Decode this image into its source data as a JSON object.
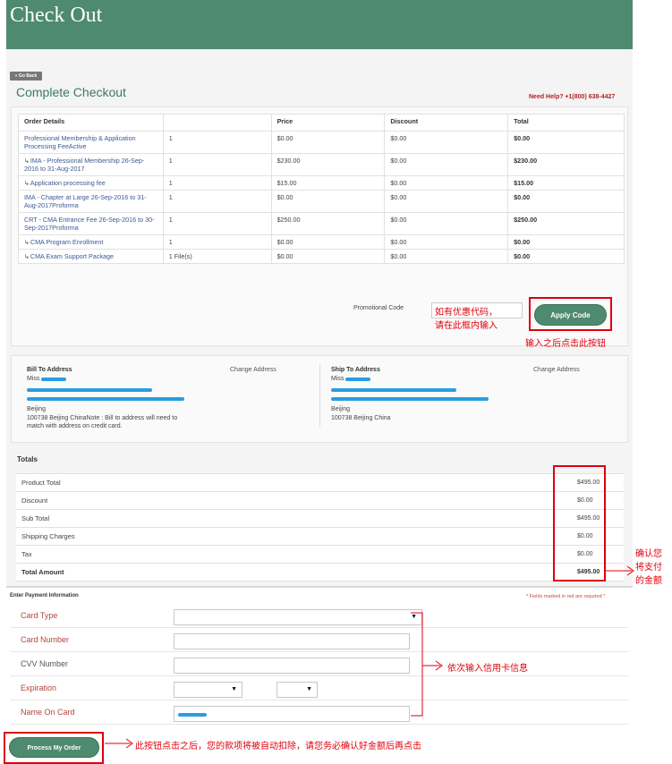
{
  "header": {
    "title": "Check Out"
  },
  "nav": {
    "go_back": "« Go Back"
  },
  "page": {
    "title": "Complete Checkout",
    "help": "Need Help? +1(800) 638-4427"
  },
  "order": {
    "columns": [
      "Order Details",
      "",
      "Price",
      "Discount",
      "Total"
    ],
    "rows": [
      {
        "sub": false,
        "item": "Professional Membership & Application Processing FeeActive",
        "qty": "1",
        "price": "$0.00",
        "discount": "$0.00",
        "total": "$0.00"
      },
      {
        "sub": true,
        "item": "IMA - Professional Membership 26-Sep-2016 to 31-Aug-2017",
        "qty": "1",
        "price": "$230.00",
        "discount": "$0.00",
        "total": "$230.00"
      },
      {
        "sub": true,
        "item": "Application processing fee",
        "qty": "1",
        "price": "$15.00",
        "discount": "$0.00",
        "total": "$15.00"
      },
      {
        "sub": false,
        "item": "IMA - Chapter at Large 26-Sep-2016 to 31-Aug-2017Proforma",
        "qty": "1",
        "price": "$0.00",
        "discount": "$0.00",
        "total": "$0.00"
      },
      {
        "sub": false,
        "item": "CRT - CMA Entrance Fee 26-Sep-2016 to 30-Sep-2017Proforma",
        "qty": "1",
        "price": "$250.00",
        "discount": "$0.00",
        "total": "$250.00"
      },
      {
        "sub": true,
        "item": "CMA Program Enrollment",
        "qty": "1",
        "price": "$0.00",
        "discount": "$0.00",
        "total": "$0.00"
      },
      {
        "sub": true,
        "item": "CMA Exam Support Package",
        "qty": "1 File(s)",
        "price": "$0.00",
        "discount": "$0.00",
        "total": "$0.00"
      }
    ],
    "promo_label": "Promotional Code",
    "apply_label": "Apply Code"
  },
  "address": {
    "bill_title": "Bill To Address",
    "bill_change": "Change Address",
    "bill_salutation": "Miss",
    "bill_city": "Beijing",
    "bill_zip_note": "100738 Beijing ChinaNote : Bill to address will need to",
    "bill_zip_note2": "match with address on credit card.",
    "ship_title": "Ship To Address",
    "ship_change": "Change Address",
    "ship_salutation": "Miss",
    "ship_city": "Beijing",
    "ship_zip": "100738 Beijing China"
  },
  "totals": {
    "title": "Totals",
    "rows": [
      {
        "label": "Product Total",
        "value": "$495.00"
      },
      {
        "label": "Discount",
        "value": "$0.00"
      },
      {
        "label": "Sub Total",
        "value": "$495.00"
      },
      {
        "label": "Shipping Charges",
        "value": "$0.00"
      },
      {
        "label": "Tax",
        "value": "$0.00"
      },
      {
        "label": "Total Amount",
        "value": "$495.00"
      }
    ]
  },
  "payment": {
    "title": "Enter Payment Information",
    "required_note": "* Fields marked in red are required *",
    "card_type": "Card Type",
    "card_number": "Card Number",
    "cvv": "CVV Number",
    "expiration": "Expiration",
    "name_on_card": "Name On Card",
    "process_label": "Process My Order"
  },
  "annotations": {
    "promo_hint_1": "如有优惠代码，",
    "promo_hint_2": "请在此框内输入",
    "apply_hint": "输入之后点击此按钮",
    "confirm_1": "确认您",
    "confirm_2": "将支付",
    "confirm_3": "的金额",
    "card_hint": "依次输入信用卡信息",
    "process_hint": "此按钮点击之后，您的款项将被自动扣除，请您务必确认好金额后再点击"
  },
  "colors": {
    "brand_green": "#4e8a6e",
    "annotation_red": "#e0000d",
    "redacted_blue": "#2a9de0"
  }
}
